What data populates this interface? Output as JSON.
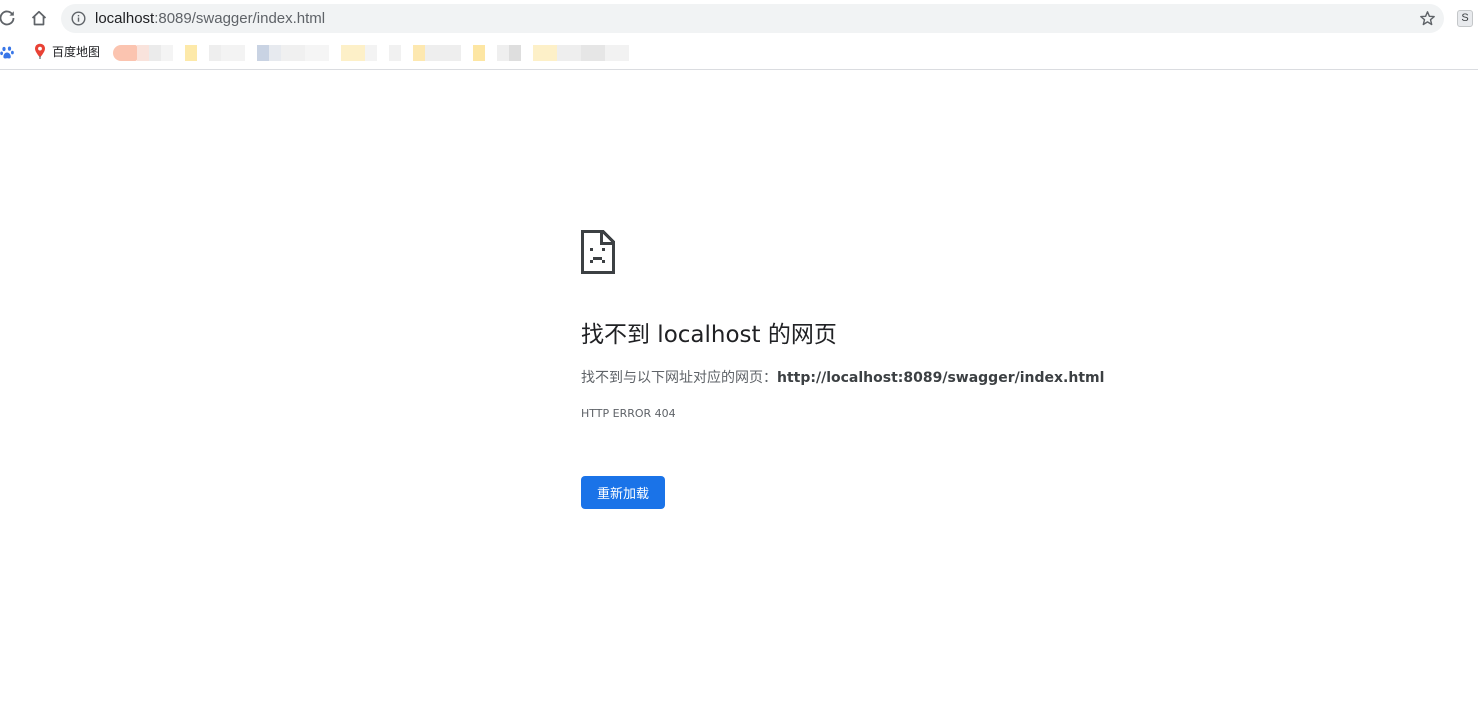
{
  "browser": {
    "url_host": "localhost",
    "url_path": ":8089/swagger/index.html",
    "extension_letter": "S"
  },
  "bookmarks": {
    "items": [
      {
        "label": "百度地图",
        "icon": "map-pin-icon"
      }
    ]
  },
  "error_page": {
    "title": "找不到 localhost 的网页",
    "description_prefix": "找不到与以下网址对应的网页：",
    "description_url": "http://localhost:8089/swagger/index.html",
    "error_code": "HTTP ERROR 404",
    "reload_label": "重新加载"
  },
  "colors": {
    "accent": "#1a73e8",
    "omnibox_bg": "#f1f3f4",
    "title_text": "#202124",
    "secondary_text": "#5f6368"
  }
}
